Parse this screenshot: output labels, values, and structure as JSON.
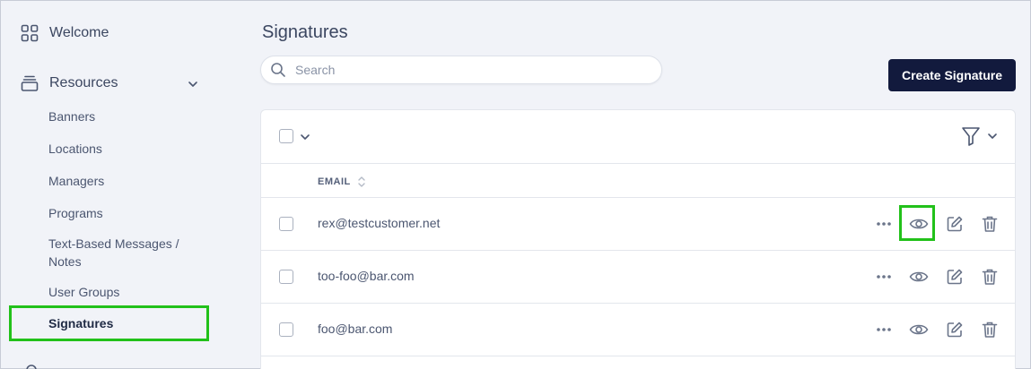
{
  "sidebar": {
    "welcome": "Welcome",
    "resources": "Resources",
    "items": [
      {
        "label": "Banners"
      },
      {
        "label": "Locations"
      },
      {
        "label": "Managers"
      },
      {
        "label": "Programs"
      },
      {
        "label": "Text-Based Messages /"
      },
      {
        "label": "Notes"
      },
      {
        "label": "User Groups"
      },
      {
        "label": "Signatures"
      }
    ]
  },
  "page": {
    "title": "Signatures",
    "search_placeholder": "Search",
    "create_label": "Create Signature"
  },
  "table": {
    "column_email": "EMAIL",
    "rows": [
      {
        "email": "rex@testcustomer.net"
      },
      {
        "email": "too-foo@bar.com"
      },
      {
        "email": "foo@bar.com"
      }
    ]
  },
  "colors": {
    "primary": "#121a3d",
    "highlight": "#22c11a",
    "background": "#f1f3f8"
  }
}
